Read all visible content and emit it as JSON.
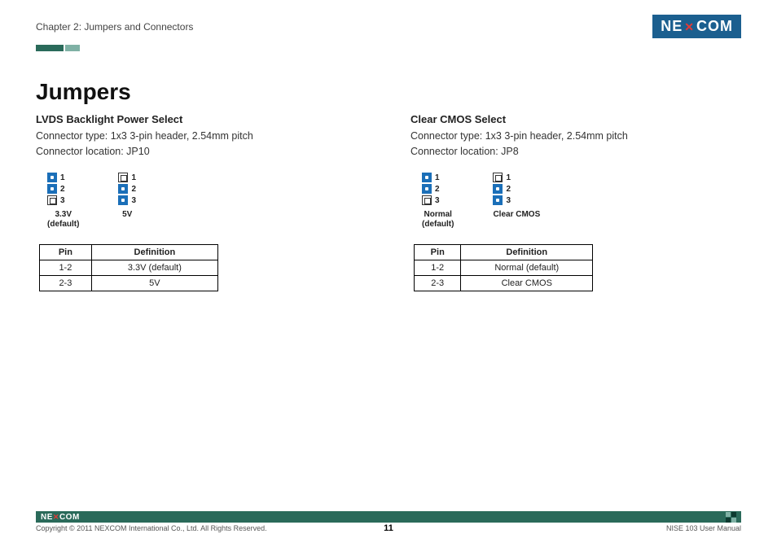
{
  "header": {
    "chapter": "Chapter 2: Jumpers and Connectors",
    "logo_left": "NE",
    "logo_right": "COM"
  },
  "title": "Jumpers",
  "left": {
    "heading": "LVDS Backlight Power Select",
    "line1": "Connector type: 1x3 3-pin header, 2.54mm pitch",
    "line2": "Connector location: JP10",
    "j1_label": "3.3V",
    "j1_sub": "(default)",
    "j2_label": "5V",
    "pin_1": "1",
    "pin_2": "2",
    "pin_3": "3",
    "th_pin": "Pin",
    "th_def": "Definition",
    "r1_pin": "1-2",
    "r1_def": "3.3V (default)",
    "r2_pin": "2-3",
    "r2_def": "5V"
  },
  "right": {
    "heading": "Clear CMOS Select",
    "line1": "Connector type: 1x3 3-pin header, 2.54mm pitch",
    "line2": "Connector location: JP8",
    "j1_label": "Normal",
    "j1_sub": "(default)",
    "j2_label": "Clear CMOS",
    "pin_1": "1",
    "pin_2": "2",
    "pin_3": "3",
    "th_pin": "Pin",
    "th_def": "Definition",
    "r1_pin": "1-2",
    "r1_def": "Normal (default)",
    "r2_pin": "2-3",
    "r2_def": "Clear CMOS"
  },
  "footer": {
    "logo_left": "NE",
    "logo_right": "COM",
    "copyright": "Copyright © 2011 NEXCOM International Co., Ltd. All Rights Reserved.",
    "page": "11",
    "manual": "NISE 103 User Manual"
  }
}
